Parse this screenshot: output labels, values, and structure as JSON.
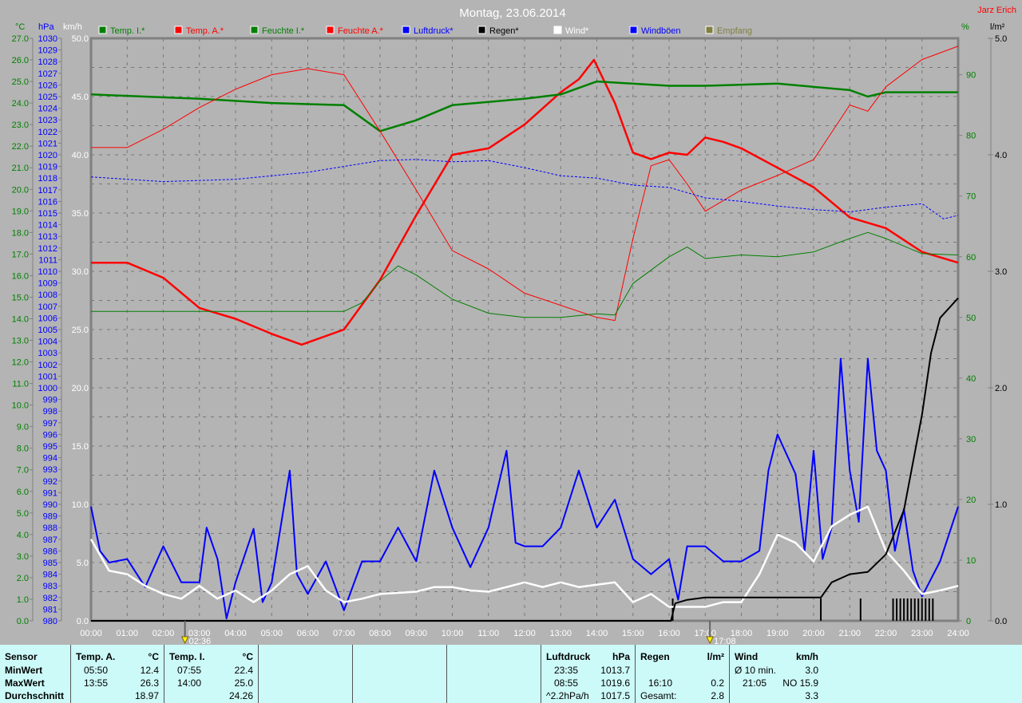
{
  "header": {
    "title": "Montag, 23.06.2014",
    "author": "Jarz Erich"
  },
  "chart_data": {
    "type": "line",
    "title": "Montag, 23.06.2014",
    "x_range_hours": [
      0,
      24
    ],
    "x_ticks": [
      "00:00",
      "01:00",
      "02:00",
      "03:00",
      "04:00",
      "05:00",
      "06:00",
      "07:00",
      "08:00",
      "09:00",
      "10:00",
      "11:00",
      "12:00",
      "13:00",
      "14:00",
      "15:00",
      "16:00",
      "17:00",
      "18:00",
      "19:00",
      "20:00",
      "21:00",
      "22:00",
      "23:00",
      "24:00"
    ],
    "axes": {
      "celsius": {
        "label": "°C",
        "range": [
          0,
          27
        ],
        "step": 1,
        "color": "#008000"
      },
      "hpa": {
        "label": "hPa",
        "range": [
          980,
          1030
        ],
        "step": 1,
        "color": "#0000ff"
      },
      "kmh": {
        "label": "km/h",
        "range": [
          0,
          50
        ],
        "step": 5,
        "color": "#ffffff"
      },
      "percent": {
        "label": "%",
        "range": [
          0,
          96
        ],
        "ticks": [
          0,
          10,
          20,
          30,
          40,
          50,
          60,
          70,
          80,
          90
        ],
        "color": "#008000"
      },
      "rain": {
        "label": "l/m²",
        "range": [
          0,
          5
        ],
        "ticks": [
          0,
          1,
          2,
          3,
          4,
          5
        ],
        "color": "#000000"
      }
    },
    "legend": [
      {
        "name": "Temp. I.*",
        "color": "#008000"
      },
      {
        "name": "Temp. A.*",
        "color": "#ff0000"
      },
      {
        "name": "Feuchte I.*",
        "color": "#008000"
      },
      {
        "name": "Feuchte A.*",
        "color": "#ff0000"
      },
      {
        "name": "Luftdruck*",
        "color": "#0000ff"
      },
      {
        "name": "Regen*",
        "color": "#000000"
      },
      {
        "name": "Wind*",
        "color": "#ffffff"
      },
      {
        "name": "Windböen",
        "color": "#0000ff"
      },
      {
        "name": "Empfang",
        "color": "#808040"
      }
    ],
    "series": [
      {
        "name": "Temp. A.",
        "axis": "celsius",
        "color": "#ff0000",
        "width": 2.5,
        "x": [
          0,
          1,
          2,
          3,
          4,
          5,
          5.83,
          6,
          7,
          8,
          9,
          10,
          11,
          12,
          13,
          13.5,
          13.92,
          14.5,
          15,
          15.5,
          16,
          16.5,
          17,
          17.5,
          18,
          19,
          20,
          21,
          22,
          23,
          24
        ],
        "y": [
          16.6,
          16.6,
          15.9,
          14.5,
          14.0,
          13.3,
          12.8,
          12.9,
          13.5,
          15.8,
          18.8,
          21.6,
          21.9,
          23.0,
          24.5,
          25.1,
          26.0,
          24.0,
          21.7,
          21.4,
          21.7,
          21.6,
          22.4,
          22.2,
          21.9,
          21.0,
          20.1,
          18.7,
          18.2,
          17.1,
          16.6
        ]
      },
      {
        "name": "Temp. I.",
        "axis": "celsius",
        "color": "#008000",
        "width": 2.5,
        "x": [
          0,
          3,
          5,
          7,
          8,
          9,
          10,
          12,
          13,
          14,
          16,
          17,
          19,
          21,
          21.5,
          22,
          24
        ],
        "y": [
          24.4,
          24.2,
          24.0,
          23.9,
          22.7,
          23.2,
          23.9,
          24.2,
          24.4,
          25.0,
          24.8,
          24.8,
          24.9,
          24.6,
          24.3,
          24.5,
          24.5
        ]
      },
      {
        "name": "Feuchte A.",
        "axis": "percent",
        "color": "#ff0000",
        "width": 1,
        "x": [
          0,
          1,
          2,
          3,
          4,
          5,
          6,
          7,
          8,
          9,
          10,
          11,
          12,
          13,
          14,
          14.5,
          15,
          15.5,
          16,
          16.5,
          17,
          18,
          19,
          20,
          21,
          21.5,
          22,
          23,
          24
        ],
        "y": [
          78,
          78,
          81,
          84.6,
          87.6,
          90,
          91,
          90,
          80.7,
          71,
          61,
          58,
          54,
          52,
          50,
          49.5,
          63,
          75,
          76,
          72,
          67.5,
          71,
          73.4,
          76,
          85,
          84,
          88,
          92.5,
          94.7
        ]
      },
      {
        "name": "Feuchte I.",
        "axis": "percent",
        "color": "#008000",
        "width": 1,
        "x": [
          0,
          7,
          7.5,
          8,
          8.5,
          9,
          10,
          11,
          12,
          13,
          14,
          14.5,
          15,
          16,
          16.5,
          17,
          18,
          19,
          20,
          21,
          21.5,
          22,
          23,
          24
        ],
        "y": [
          51,
          51,
          52.4,
          56,
          58.5,
          57,
          53,
          50.7,
          50,
          50,
          50.6,
          50.4,
          55.6,
          60,
          61.6,
          59.7,
          60.3,
          60,
          60.8,
          63,
          64,
          63,
          60.5,
          60.3
        ]
      },
      {
        "name": "Luftdruck",
        "axis": "hpa",
        "color": "#0000ff",
        "width": 1,
        "dash": "3,2",
        "x": [
          0,
          2,
          4,
          6,
          8,
          9,
          10,
          11,
          12,
          13,
          14,
          15,
          16,
          17,
          18,
          19,
          20,
          21,
          22,
          23,
          23.6,
          24
        ],
        "y": [
          1018.1,
          1017.7,
          1017.9,
          1018.5,
          1019.5,
          1019.6,
          1019.4,
          1019.5,
          1018.9,
          1018.2,
          1018.0,
          1017.4,
          1017.2,
          1016.3,
          1016.0,
          1015.6,
          1015.3,
          1015.1,
          1015.5,
          1015.8,
          1014.5,
          1014.8
        ]
      },
      {
        "name": "Windböen",
        "axis": "kmh",
        "color": "#0000ff",
        "width": 2,
        "x": [
          0,
          0.25,
          0.5,
          1,
          1.5,
          2,
          2.5,
          3,
          3.2,
          3.5,
          3.75,
          4,
          4.5,
          4.75,
          5,
          5.5,
          5.7,
          6,
          6.5,
          7,
          7.5,
          8,
          8.5,
          9,
          9.5,
          10,
          10.5,
          11,
          11.5,
          11.75,
          12,
          12.5,
          13,
          13.5,
          14,
          14.5,
          15,
          15.5,
          16,
          16.25,
          16.5,
          17,
          17.5,
          18,
          18.5,
          18.75,
          19,
          19.5,
          19.75,
          20,
          20.25,
          20.5,
          20.75,
          21,
          21.25,
          21.5,
          21.75,
          22,
          22.25,
          22.5,
          22.75,
          23,
          23.5,
          24
        ],
        "y": [
          9.8,
          6.0,
          5.0,
          5.3,
          2.9,
          6.4,
          3.3,
          3.3,
          8.0,
          5.3,
          0.2,
          3.3,
          7.9,
          1.6,
          3.3,
          12.9,
          4.0,
          2.3,
          5.1,
          0.9,
          5.1,
          5.1,
          8.0,
          5.1,
          12.9,
          8.0,
          4.6,
          8.0,
          14.6,
          6.7,
          6.4,
          6.4,
          8.0,
          12.9,
          8.0,
          10.4,
          5.3,
          4.0,
          5.3,
          1.8,
          6.4,
          6.4,
          5.1,
          5.1,
          6.0,
          12.9,
          16.0,
          12.6,
          6.0,
          14.6,
          5.3,
          8.0,
          22.5,
          12.9,
          8.5,
          22.5,
          14.6,
          12.9,
          6.0,
          9.6,
          4.3,
          2.1,
          5.1,
          9.8
        ]
      },
      {
        "name": "Wind",
        "axis": "kmh",
        "color": "#ffffff",
        "width": 2.5,
        "x": [
          0,
          0.5,
          1,
          1.5,
          2,
          2.5,
          3,
          3.5,
          4,
          4.5,
          5,
          5.5,
          6,
          6.5,
          7,
          7.5,
          8,
          8.5,
          9,
          9.5,
          10,
          10.5,
          11,
          11.5,
          12,
          12.5,
          13,
          13.5,
          14,
          14.5,
          15,
          15.5,
          16,
          16.5,
          17,
          17.5,
          18,
          18.5,
          19,
          19.5,
          20,
          20.5,
          21,
          21.5,
          22,
          22.5,
          23,
          23.5,
          24
        ],
        "y": [
          7.0,
          4.3,
          4.0,
          3.0,
          2.3,
          1.9,
          3.0,
          1.9,
          2.6,
          1.6,
          2.6,
          4.0,
          4.7,
          2.6,
          1.6,
          1.9,
          2.3,
          2.4,
          2.5,
          2.9,
          2.9,
          2.6,
          2.5,
          2.9,
          3.3,
          2.9,
          3.3,
          2.9,
          3.1,
          3.3,
          1.6,
          2.3,
          1.2,
          1.2,
          1.2,
          1.6,
          1.6,
          4.0,
          7.4,
          6.7,
          5.1,
          8.1,
          9.1,
          9.8,
          6.0,
          4.3,
          2.3,
          2.6,
          3.0
        ]
      },
      {
        "name": "Regen",
        "axis": "rain",
        "color": "#000000",
        "width": 2,
        "x": [
          0,
          16.05,
          16.17,
          16.5,
          17,
          20.2,
          20.5,
          21,
          21.5,
          22,
          22.5,
          23,
          23.25,
          23.5,
          24
        ],
        "y": [
          0,
          0,
          0.15,
          0.18,
          0.2,
          0.2,
          0.33,
          0.4,
          0.42,
          0.57,
          0.95,
          1.77,
          2.3,
          2.6,
          2.77
        ]
      }
    ],
    "rain_events_hours": [
      16.1,
      20.2,
      21.3,
      22.2,
      22.3,
      22.4,
      22.5,
      22.6,
      22.7,
      22.8,
      22.9,
      23.0,
      23.1,
      23.2,
      23.3
    ],
    "markers": [
      {
        "time": "02:36",
        "hour": 2.6
      },
      {
        "time": "17:08",
        "hour": 17.13
      }
    ]
  },
  "table": {
    "rows": [
      "Sensor",
      "MinWert",
      "MaxWert",
      "Durchschnitt"
    ],
    "temp_a": {
      "title": "Temp. A.",
      "unit": "°C",
      "min_time": "05:50",
      "min": "12.4",
      "max_time": "13:55",
      "max": "26.3",
      "avg": "18.97"
    },
    "temp_i": {
      "title": "Temp. I.",
      "unit": "°C",
      "min_time": "07:55",
      "min": "22.4",
      "max_time": "14:00",
      "max": "25.0",
      "avg": "24.26"
    },
    "luftdruck": {
      "title": "Luftdruck",
      "unit": "hPa",
      "min_time": "23:35",
      "min": "1013.7",
      "max_time": "08:55",
      "max": "1019.6",
      "trend": "^2.2hPa/h",
      "avg": "1017.5"
    },
    "regen": {
      "title": "Regen",
      "unit": "l/m²",
      "max_time": "16:10",
      "max": "0.2",
      "total_label": "Gesamt:",
      "total": "2.8"
    },
    "wind": {
      "title": "Wind",
      "unit": "km/h",
      "avg_label": "Ø 10 min.",
      "avg10": "3.0",
      "max_time": "21:05",
      "max": "NO 15.9",
      "avg": "3.3"
    }
  }
}
